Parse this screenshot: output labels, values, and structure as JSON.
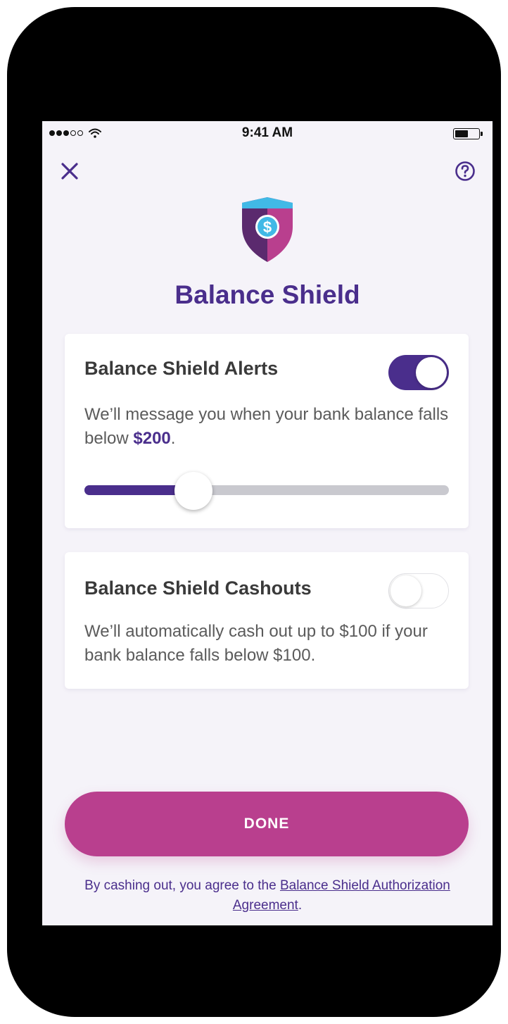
{
  "status_bar": {
    "time": "9:41 AM",
    "signal_icon": "signal-dots-icon",
    "wifi_icon": "wifi-icon",
    "battery_icon": "battery-icon",
    "battery_level": 0.55
  },
  "nav": {
    "close_icon": "close-icon",
    "help_icon": "help-question-icon"
  },
  "header": {
    "logo_icon": "shield-dollar-icon",
    "title": "Balance Shield"
  },
  "alerts_card": {
    "title": "Balance Shield Alerts",
    "enabled": true,
    "desc_before": "We’ll message you when your bank balance falls below ",
    "threshold": "$200",
    "desc_after": ".",
    "slider_fraction": 0.3
  },
  "cashouts_card": {
    "title": "Balance Shield Cashouts",
    "enabled": false,
    "desc": "We’ll automatically cash out up to $100 if your bank balance falls below $100."
  },
  "footer": {
    "done_label": "DONE",
    "disclaimer_before": "By cashing out, you agree to the ",
    "agreement_link": "Balance Shield Authorization Agreement",
    "disclaimer_after": "."
  },
  "colors": {
    "brand_purple": "#4a2e8c",
    "button_magenta": "#b93f8e",
    "background": "#f5f3f9",
    "shield_blue": "#41b9e6",
    "shield_dark": "#5b2a6e"
  }
}
